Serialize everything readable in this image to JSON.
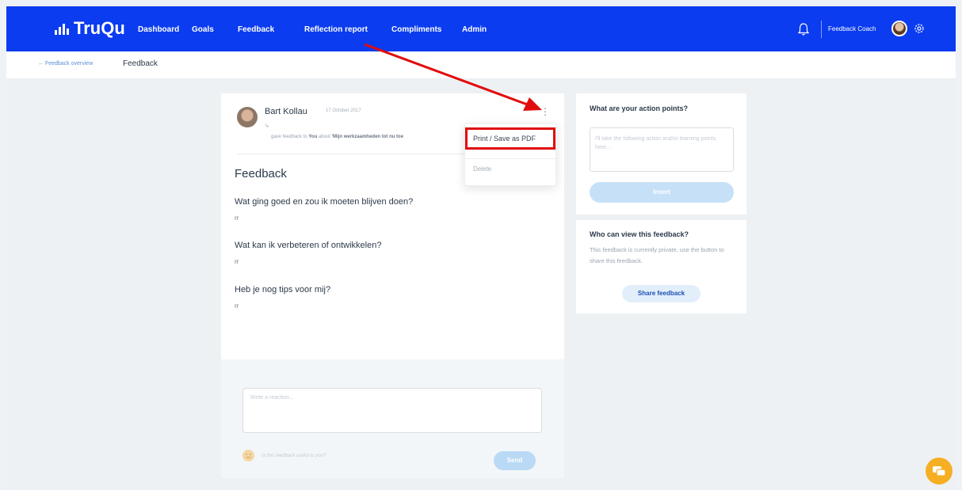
{
  "app": {
    "logo": "TruQu"
  },
  "nav": {
    "items": [
      {
        "label": "Dashboard"
      },
      {
        "label": "Goals"
      },
      {
        "label": "Feedback"
      },
      {
        "label": "Reflection report"
      },
      {
        "label": "Compliments"
      },
      {
        "label": "Admin"
      }
    ],
    "user_role": "Feedback Coach"
  },
  "breadcrumb": {
    "back": "← Feedback overview",
    "current": "Feedback"
  },
  "feedback": {
    "author": "Bart Kollau",
    "date": "17 October 2017",
    "sub": "↳",
    "meta_prefix": "gave feedback to ",
    "meta_you": "You",
    "meta_mid": " about ",
    "meta_topic": "'Mijn werkzaamheden tot nu toe",
    "title": "Feedback",
    "questions": [
      {
        "q": "Wat ging goed en zou ik moeten blijven doen?",
        "a": "rr"
      },
      {
        "q": "Wat kan ik verbeteren of ontwikkelen?",
        "a": "rr"
      },
      {
        "q": "Heb je nog tips voor mij?",
        "a": "rr"
      }
    ]
  },
  "menu": {
    "print": "Print / Save as PDF",
    "delete": "Delete"
  },
  "reaction": {
    "placeholder": "Write a reaction...",
    "useful": "- Is this feedback useful to you?",
    "send": "Send"
  },
  "actions": {
    "title": "What are your action points?",
    "placeholder": "I'll take the following action and/or learning points here...",
    "insert": "Insert"
  },
  "viewers": {
    "title": "Who can view this feedback?",
    "text": "This feedback is currently private, use the button to share this feedback.",
    "share": "Share feedback"
  },
  "colors": {
    "brand": "#0b3cf0",
    "highlight": "#e10d0d",
    "chat": "#f6ae22"
  }
}
